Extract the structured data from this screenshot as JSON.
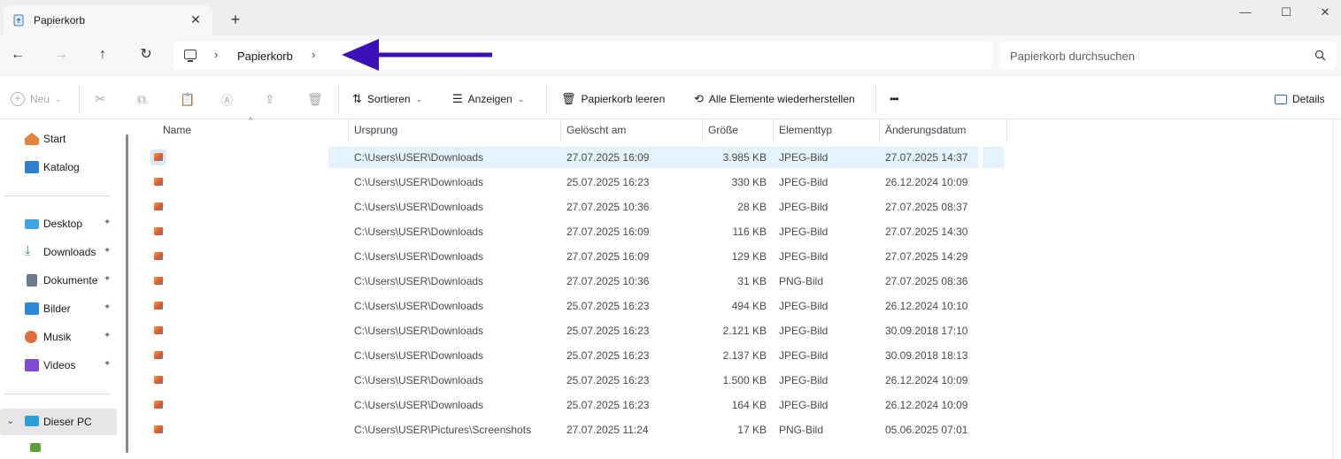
{
  "window": {
    "tab_title": "Papierkorb",
    "close_tab": "✕",
    "new_tab": "+",
    "minimize": "—",
    "maximize": "☐",
    "close": "✕"
  },
  "nav": {
    "back": "←",
    "forward": "→",
    "up": "↑",
    "refresh": "↻",
    "breadcrumb": "Papierkorb",
    "chevron": "›",
    "search_placeholder": "Papierkorb durchsuchen"
  },
  "toolbar": {
    "new_label": "Neu",
    "sort_label": "Sortieren",
    "view_label": "Anzeigen",
    "empty_bin_label": "Papierkorb leeren",
    "restore_all_label": "Alle Elemente wiederherstellen",
    "more_label": "•••",
    "details_label": "Details"
  },
  "sidebar": {
    "items": [
      {
        "label": "Start",
        "icon": "home-icon",
        "color": "#e4843f"
      },
      {
        "label": "Katalog",
        "icon": "gallery-icon",
        "color": "#2f7fd0"
      },
      {
        "label": "Desktop",
        "icon": "desktop-icon",
        "color": "#3aa4e4",
        "pinned": true
      },
      {
        "label": "Downloads",
        "icon": "download-icon",
        "color": "#1fa37a",
        "pinned": true
      },
      {
        "label": "Dokumente",
        "icon": "documents-icon",
        "color": "#6c7a8e",
        "pinned": true
      },
      {
        "label": "Bilder",
        "icon": "pictures-icon",
        "color": "#2e86d8",
        "pinned": true
      },
      {
        "label": "Musik",
        "icon": "music-icon",
        "color": "#e06b3c",
        "pinned": true
      },
      {
        "label": "Videos",
        "icon": "videos-icon",
        "color": "#7d4ad6",
        "pinned": true
      },
      {
        "label": "Dieser PC",
        "icon": "pc-icon",
        "color": "#2ba0d8"
      }
    ],
    "pin_glyph": "📌",
    "expand_glyph": "⌄"
  },
  "columns": {
    "name": "Name",
    "origin": "Ursprung",
    "deleted": "Gelöscht am",
    "size": "Größe",
    "type": "Elementtyp",
    "modified": "Änderungsdatum"
  },
  "files": [
    {
      "origin": "C:\\Users\\USER\\Downloads",
      "deleted": "27.07.2025 16:09",
      "size": "3.985 KB",
      "type": "JPEG-Bild",
      "modified": "27.07.2025 14:37"
    },
    {
      "origin": "C:\\Users\\USER\\Downloads",
      "deleted": "25.07.2025 16:23",
      "size": "330 KB",
      "type": "JPEG-Bild",
      "modified": "26.12.2024 10:09"
    },
    {
      "origin": "C:\\Users\\USER\\Downloads",
      "deleted": "27.07.2025 10:36",
      "size": "28 KB",
      "type": "JPEG-Bild",
      "modified": "27.07.2025 08:37"
    },
    {
      "origin": "C:\\Users\\USER\\Downloads",
      "deleted": "27.07.2025 16:09",
      "size": "116 KB",
      "type": "JPEG-Bild",
      "modified": "27.07.2025 14:30"
    },
    {
      "origin": "C:\\Users\\USER\\Downloads",
      "deleted": "27.07.2025 16:09",
      "size": "129 KB",
      "type": "JPEG-Bild",
      "modified": "27.07.2025 14:29"
    },
    {
      "origin": "C:\\Users\\USER\\Downloads",
      "deleted": "27.07.2025 10:36",
      "size": "31 KB",
      "type": "PNG-Bild",
      "modified": "27.07.2025 08:36"
    },
    {
      "origin": "C:\\Users\\USER\\Downloads",
      "deleted": "25.07.2025 16:23",
      "size": "494 KB",
      "type": "JPEG-Bild",
      "modified": "26.12.2024 10:10"
    },
    {
      "origin": "C:\\Users\\USER\\Downloads",
      "deleted": "25.07.2025 16:23",
      "size": "2.121 KB",
      "type": "JPEG-Bild",
      "modified": "30.09.2018 17:10"
    },
    {
      "origin": "C:\\Users\\USER\\Downloads",
      "deleted": "25.07.2025 16:23",
      "size": "2.137 KB",
      "type": "JPEG-Bild",
      "modified": "30.09.2018 18:13"
    },
    {
      "origin": "C:\\Users\\USER\\Downloads",
      "deleted": "25.07.2025 16:23",
      "size": "1.500 KB",
      "type": "JPEG-Bild",
      "modified": "26.12.2024 10:09"
    },
    {
      "origin": "C:\\Users\\USER\\Downloads",
      "deleted": "25.07.2025 16:23",
      "size": "164 KB",
      "type": "JPEG-Bild",
      "modified": "26.12.2024 10:09"
    },
    {
      "origin": "C:\\Users\\USER\\Pictures\\Screenshots",
      "deleted": "27.07.2025 11:24",
      "size": "17 KB",
      "type": "PNG-Bild",
      "modified": "05.06.2025 07:01"
    }
  ],
  "colors": {
    "accent_arrow": "#3b10b8",
    "selection": "#e5f3fc"
  }
}
